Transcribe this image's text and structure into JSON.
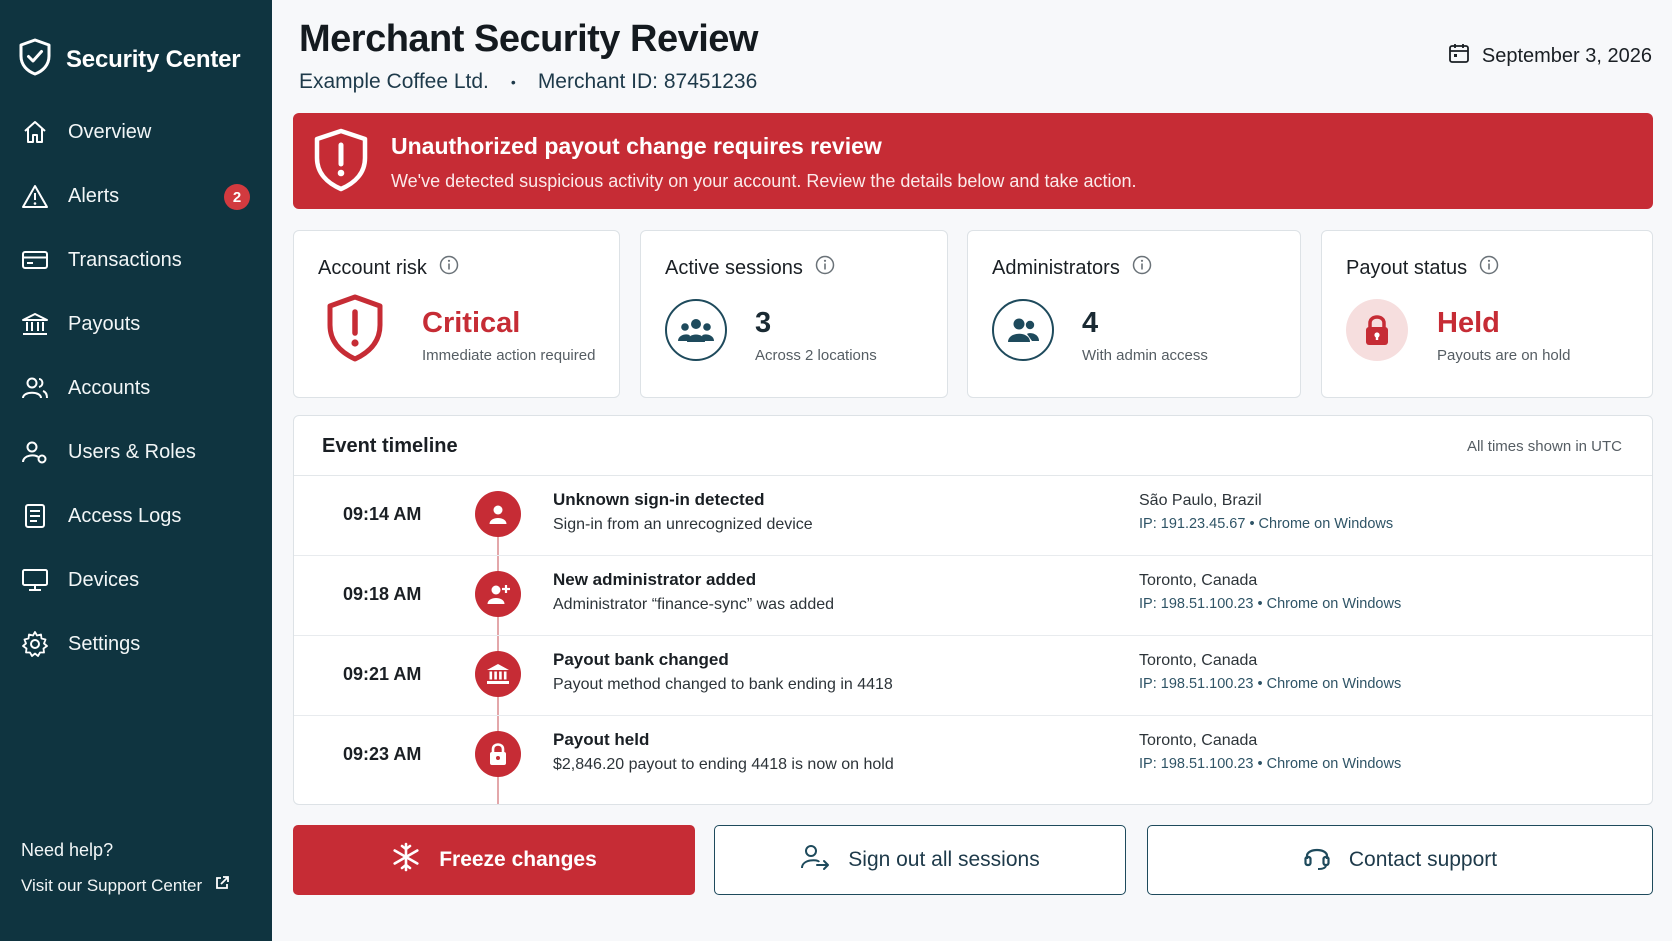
{
  "sidebar": {
    "brand": "Security Center",
    "items": [
      {
        "label": "Overview",
        "icon": "home-icon"
      },
      {
        "label": "Alerts",
        "icon": "warning-icon",
        "badge": "2"
      },
      {
        "label": "Transactions",
        "icon": "card-icon"
      },
      {
        "label": "Payouts",
        "icon": "bank-icon"
      },
      {
        "label": "Accounts",
        "icon": "users-icon"
      },
      {
        "label": "Users & Roles",
        "icon": "user-gear-icon"
      },
      {
        "label": "Access Logs",
        "icon": "document-icon"
      },
      {
        "label": "Devices",
        "icon": "monitor-icon"
      },
      {
        "label": "Settings",
        "icon": "gear-icon"
      }
    ],
    "help_title": "Need help?",
    "help_link": "Visit our Support Center"
  },
  "header": {
    "title": "Merchant Security Review",
    "merchant": "Example Coffee Ltd.",
    "separator": "•",
    "merchant_id": "Merchant ID: 87451236",
    "date": "September 3, 2026"
  },
  "alert": {
    "title": "Unauthorized payout change requires review",
    "text": "We've detected suspicious activity on your account. Review the details below and take action."
  },
  "cards": [
    {
      "label": "Account risk",
      "value": "Critical",
      "sub": "Immediate action required"
    },
    {
      "label": "Active sessions",
      "value": "3",
      "sub": "Across 2 locations"
    },
    {
      "label": "Administrators",
      "value": "4",
      "sub": "With admin access"
    },
    {
      "label": "Payout status",
      "value": "Held",
      "sub": "Payouts are on hold"
    }
  ],
  "timeline": {
    "title": "Event timeline",
    "note": "All times shown in UTC",
    "events": [
      {
        "time": "09:14 AM",
        "event": "Unknown sign-in detected",
        "detail": "Sign-in from an unrecognized device",
        "location": "São Paulo, Brazil",
        "ip": "IP: 191.23.45.67  •  Chrome on Windows",
        "icon": "user-icon"
      },
      {
        "time": "09:18 AM",
        "event": "New administrator added",
        "detail": "Administrator “finance-sync” was added",
        "location": "Toronto, Canada",
        "ip": "IP: 198.51.100.23  •  Chrome on Windows",
        "icon": "user-add-icon"
      },
      {
        "time": "09:21 AM",
        "event": "Payout bank changed",
        "detail": "Payout method changed to bank ending in 4418",
        "location": "Toronto, Canada",
        "ip": "IP: 198.51.100.23  •  Chrome on Windows",
        "icon": "bank-icon"
      },
      {
        "time": "09:23 AM",
        "event": "Payout held",
        "detail": "$2,846.20 payout to ending 4418 is now on hold",
        "location": "Toronto, Canada",
        "ip": "IP: 198.51.100.23  •  Chrome on Windows",
        "icon": "lock-icon"
      }
    ]
  },
  "actions": {
    "freeze": "Freeze changes",
    "signout": "Sign out all sessions",
    "support": "Contact support"
  },
  "colors": {
    "sidebar": "#0f3440",
    "danger": "#c62c35",
    "accent": "#1e4a5c"
  }
}
